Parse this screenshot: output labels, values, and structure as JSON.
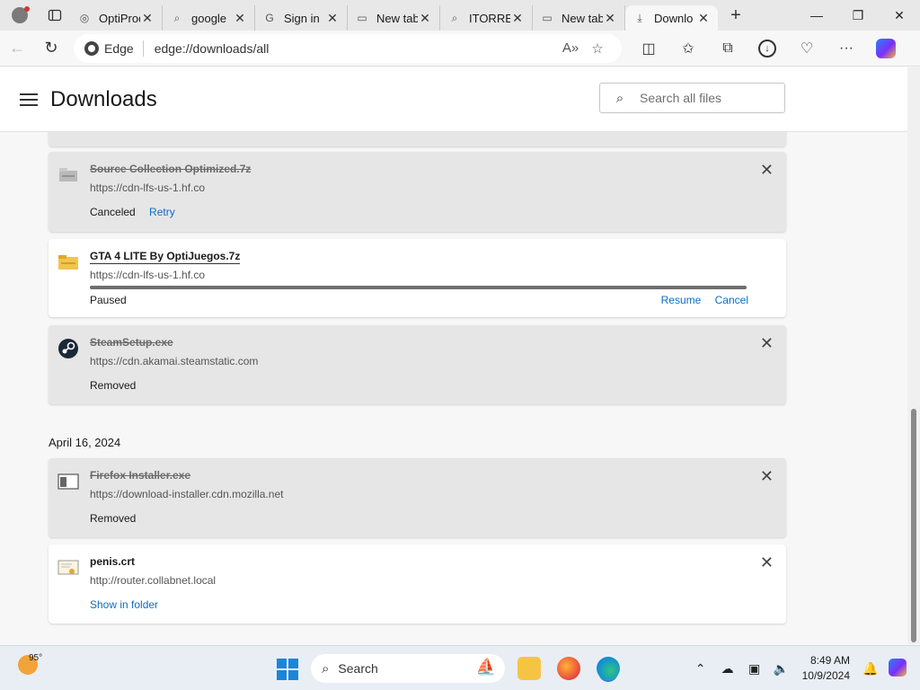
{
  "tabs": [
    {
      "title": "OptiProd",
      "icon": "optiprod-favicon",
      "active": false
    },
    {
      "title": "google",
      "icon": "search-icon",
      "active": false
    },
    {
      "title": "Sign in",
      "icon": "google-g-icon",
      "active": false
    },
    {
      "title": "New tab",
      "icon": "newtab-icon",
      "active": false
    },
    {
      "title": "ITORREN",
      "icon": "search-icon",
      "active": false
    },
    {
      "title": "New tab",
      "icon": "newtab-icon",
      "active": false
    },
    {
      "title": "Downlo",
      "icon": "download-icon",
      "active": true
    }
  ],
  "address": {
    "chip": "Edge",
    "url": "edge://downloads/all"
  },
  "header": {
    "title": "Downloads",
    "search_placeholder": "Search all files"
  },
  "downloads": [
    {
      "name": "Source Collection Optimized.7z",
      "url": "https://cdn-lfs-us-1.hf.co",
      "status": "Canceled",
      "action": "Retry",
      "state": "canceled",
      "icon": "archive-file-icon"
    },
    {
      "name": "GTA 4 LITE By OptiJuegos.7z",
      "url": "https://cdn-lfs-us-1.hf.co",
      "status": "Paused",
      "actions": [
        "Resume",
        "Cancel"
      ],
      "state": "paused",
      "progress": 1.0,
      "icon": "folder-zip-icon"
    },
    {
      "name": "SteamSetup.exe",
      "url": "https://cdn.akamai.steamstatic.com",
      "status": "Removed",
      "state": "removed",
      "icon": "steam-icon"
    }
  ],
  "date_group": "April 16, 2024",
  "downloads_group2": [
    {
      "name": "Firefox Installer.exe",
      "url": "https://download-installer.cdn.mozilla.net",
      "status": "Removed",
      "state": "removed",
      "icon": "installer-icon"
    },
    {
      "name": "penis.crt",
      "url": "http://router.collabnet.local",
      "action": "Show in folder",
      "state": "complete",
      "icon": "certificate-icon"
    }
  ],
  "taskbar": {
    "temperature": "95°",
    "search_label": "Search",
    "time": "8:49 AM",
    "date": "10/9/2024"
  },
  "colors": {
    "link": "#0f6cbd",
    "accent": "#0078d4"
  }
}
